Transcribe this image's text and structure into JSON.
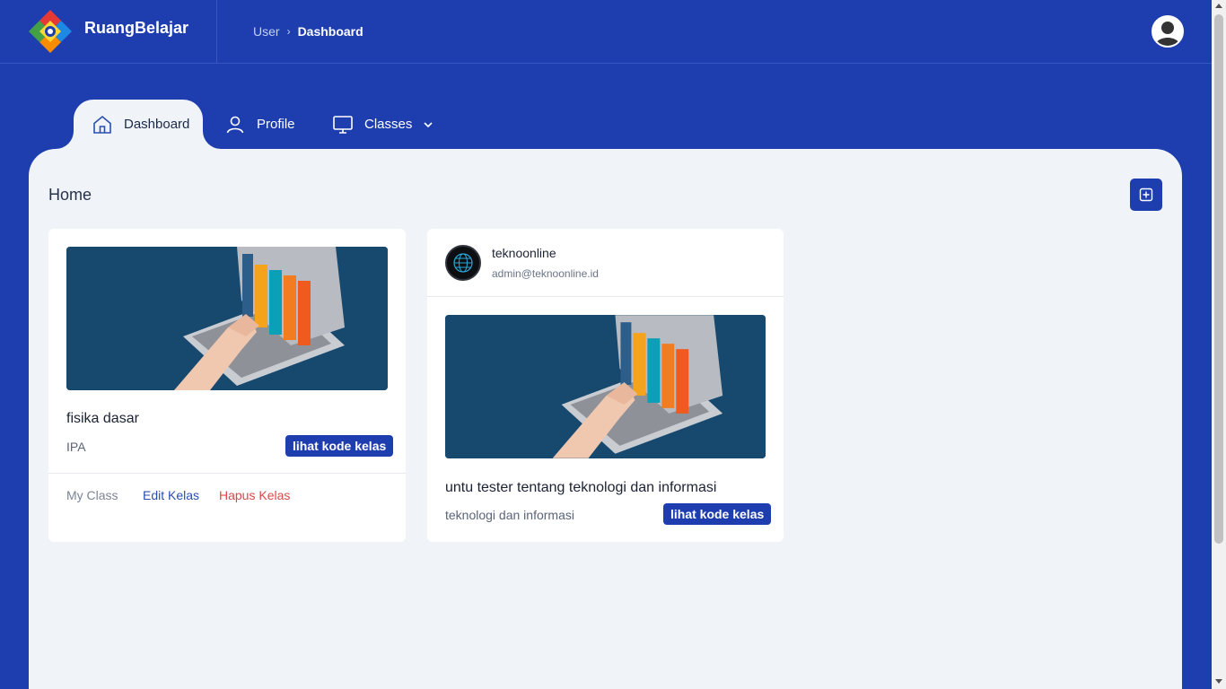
{
  "brand": {
    "name": "RuangBelajar",
    "logo_icon": "diamond-logo-icon"
  },
  "breadcrumb": {
    "items": [
      "User",
      "Dashboard"
    ],
    "separator": "›"
  },
  "user_menu": {
    "avatar_icon": "user-avatar-icon"
  },
  "tabs": [
    {
      "label": "Dashboard",
      "icon": "home-icon",
      "active": true
    },
    {
      "label": "Profile",
      "icon": "user-icon",
      "active": false
    },
    {
      "label": "Classes",
      "icon": "monitor-icon",
      "active": false,
      "has_dropdown": true
    }
  ],
  "main": {
    "title": "Home",
    "add_button_icon": "plus-square-icon"
  },
  "cards": [
    {
      "title": "fisika dasar",
      "subject": "IPA",
      "code_button": "lihat kode kelas",
      "links": {
        "my_class": "My Class",
        "edit": "Edit Kelas",
        "delete": "Hapus Kelas"
      }
    },
    {
      "owner_name": "teknoonline",
      "owner_email": "admin@teknoonline.id",
      "title": "untu tester tentang teknologi dan informasi",
      "subject": "teknologi dan informasi",
      "code_button": "lihat kode kelas"
    }
  ],
  "colors": {
    "primary": "#1e3eb0",
    "panel": "#f0f3f8",
    "danger": "#d94848",
    "link": "#2a4fb0"
  }
}
